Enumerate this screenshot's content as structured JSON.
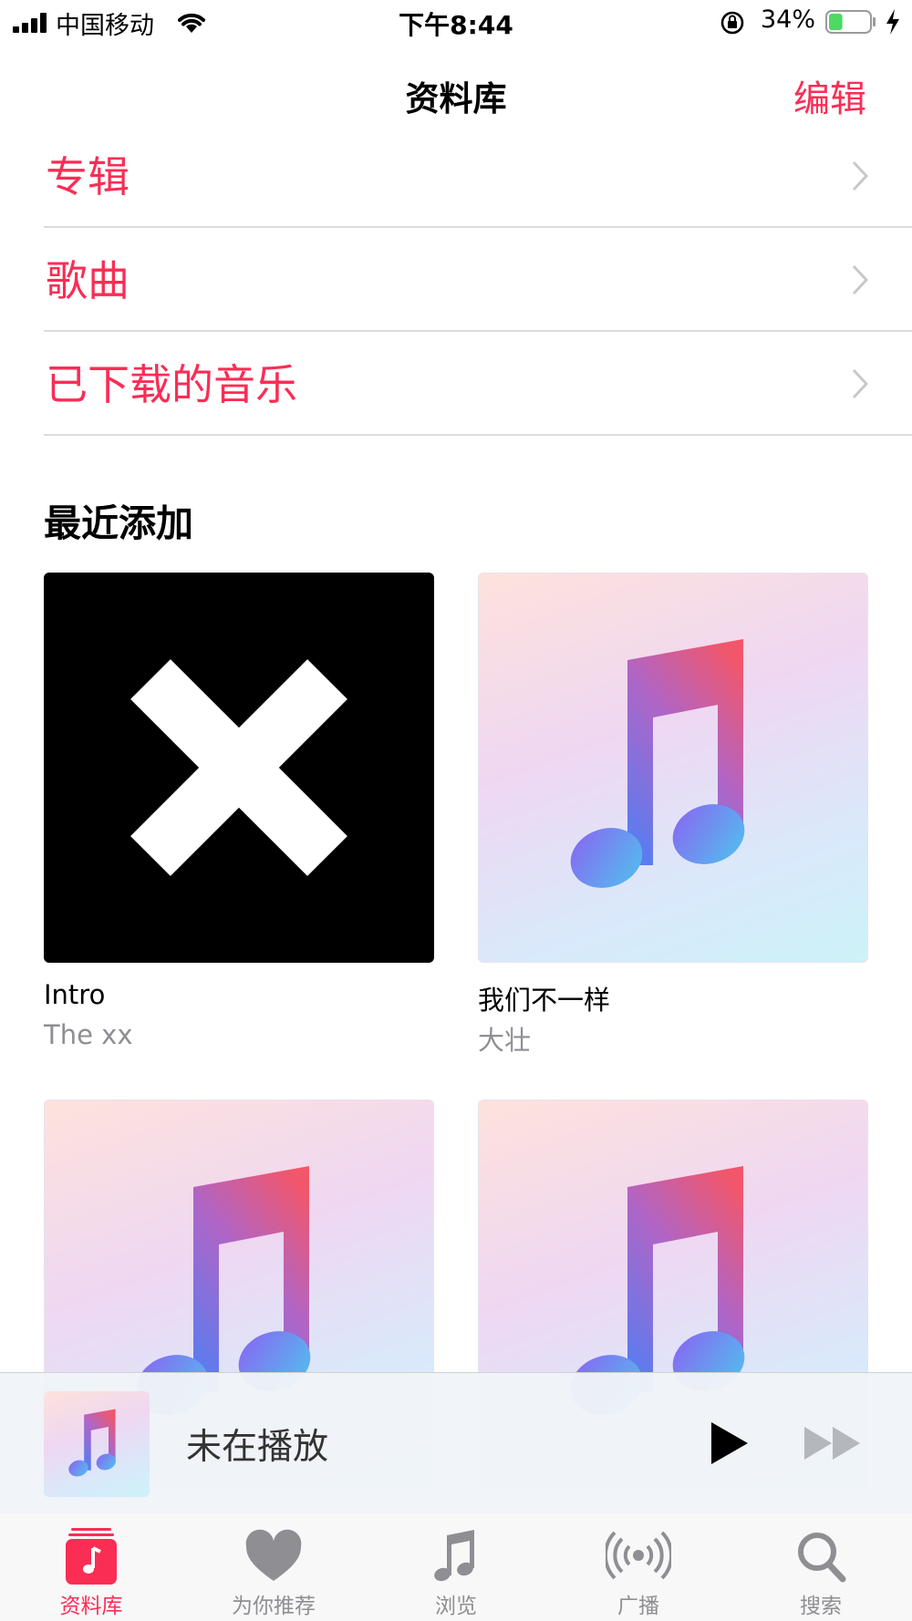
{
  "status_bar": {
    "carrier": "中国移动",
    "time": "下午8:44",
    "battery_percent": "34%",
    "battery_level": 0.34
  },
  "nav": {
    "title": "资料库",
    "edit_label": "编辑"
  },
  "library_rows": [
    {
      "label": "专辑"
    },
    {
      "label": "歌曲"
    },
    {
      "label": "已下载的音乐"
    }
  ],
  "recently_added": {
    "title": "最近添加",
    "albums": [
      {
        "title": "Intro",
        "artist": "The xx",
        "cover": "x-logo"
      },
      {
        "title": "我们不一样",
        "artist": "大壮",
        "cover": "music-note-placeholder"
      },
      {
        "title": "",
        "artist": "",
        "cover": "music-note-placeholder"
      },
      {
        "title": "",
        "artist": "",
        "cover": "music-note-placeholder"
      }
    ]
  },
  "mini_player": {
    "title": "未在播放",
    "play_icon": "play-icon",
    "forward_icon": "fast-forward-icon"
  },
  "tab_bar": {
    "tabs": [
      {
        "label": "资料库",
        "icon": "library-icon",
        "active": true
      },
      {
        "label": "为你推荐",
        "icon": "heart-icon",
        "active": false
      },
      {
        "label": "浏览",
        "icon": "music-note-icon",
        "active": false
      },
      {
        "label": "广播",
        "icon": "radio-icon",
        "active": false
      },
      {
        "label": "搜索",
        "icon": "search-icon",
        "active": false
      }
    ]
  },
  "colors": {
    "accent": "#fa2d55",
    "secondary_text": "#8e8e93"
  }
}
